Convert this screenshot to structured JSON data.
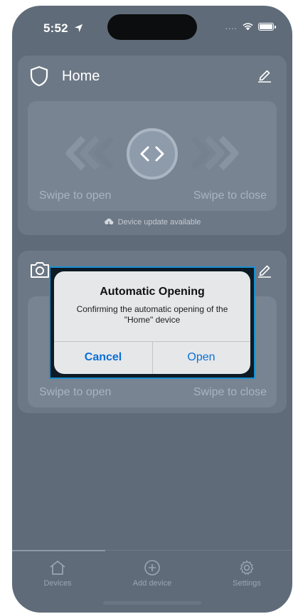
{
  "status_bar": {
    "time": "5:52",
    "signal": "....",
    "icons": [
      "location-arrow-icon",
      "wifi-icon",
      "battery-icon"
    ]
  },
  "devices": [
    {
      "title": "Home",
      "icon": "shield-icon",
      "swipe_open_label": "Swipe to open",
      "swipe_close_label": "Swipe to close",
      "update_notice": "Device update available"
    },
    {
      "title": "",
      "icon": "camera-icon",
      "swipe_open_label": "Swipe to open",
      "swipe_close_label": "Swipe to close"
    }
  ],
  "alert": {
    "title": "Automatic Opening",
    "message": "Confirming the automatic opening of the \"Home\" device",
    "cancel_label": "Cancel",
    "open_label": "Open"
  },
  "tabbar": {
    "tabs": [
      {
        "label": "Devices",
        "icon": "house-icon"
      },
      {
        "label": "Add device",
        "icon": "plus-circle-icon"
      },
      {
        "label": "Settings",
        "icon": "gear-icon"
      }
    ]
  },
  "colors": {
    "background": "#5f6b78",
    "accent": "#0a6fd8",
    "highlight_border": "#1a8fd0"
  }
}
